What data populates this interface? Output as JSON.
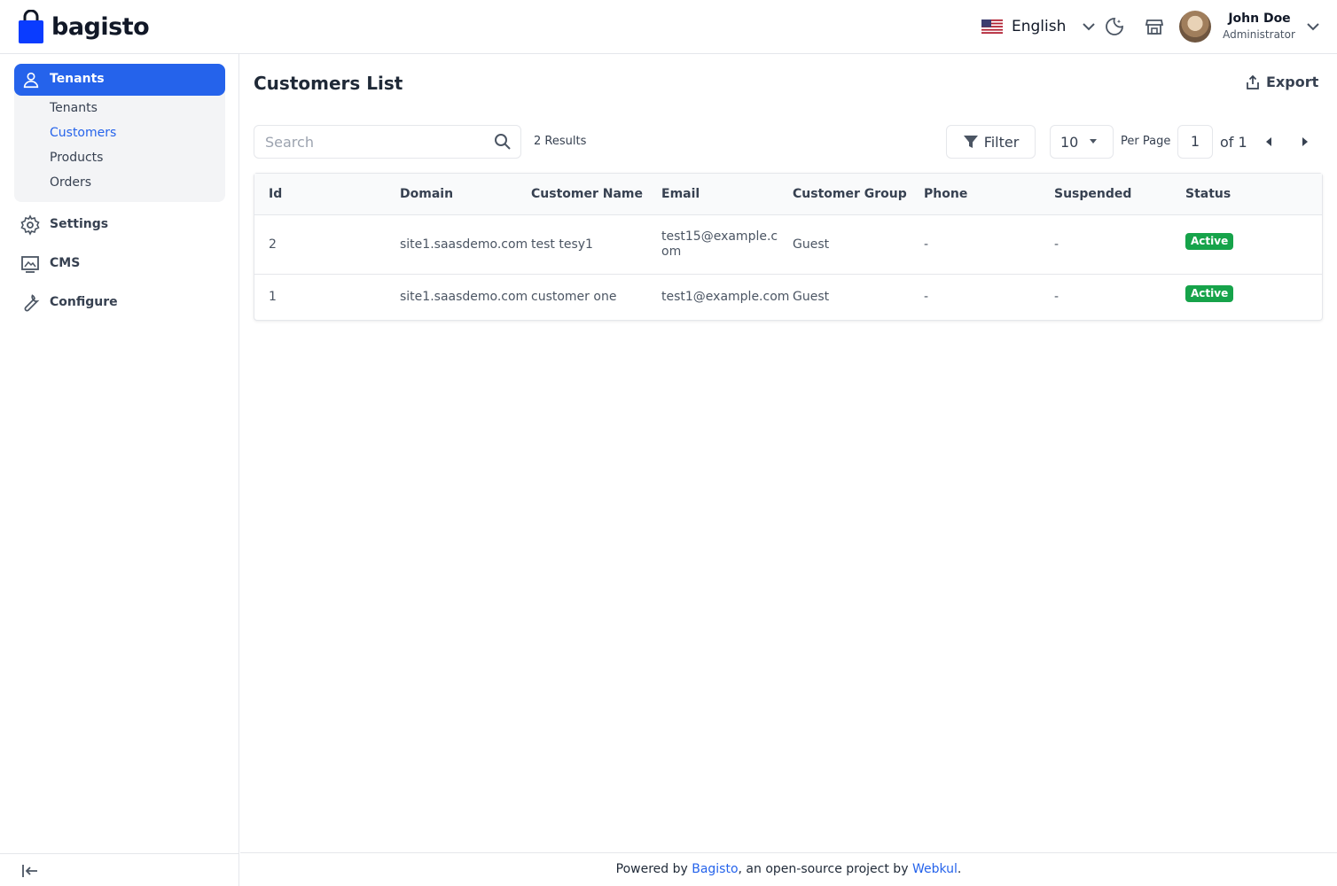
{
  "header": {
    "brand": "bagisto",
    "language": "English",
    "user_name": "John Doe",
    "user_role": "Administrator",
    "icons": [
      "us-flag-icon",
      "chevron-down-icon",
      "dark-mode-icon",
      "storefront-icon",
      "avatar",
      "chevron-down-icon"
    ]
  },
  "sidebar": {
    "active_section": "Tenants",
    "sub_items": [
      {
        "label": "Tenants"
      },
      {
        "label": "Customers"
      },
      {
        "label": "Products"
      },
      {
        "label": "Orders"
      }
    ],
    "active_sub_item": "Customers",
    "items": [
      {
        "label": "Settings",
        "icon": "gear-icon"
      },
      {
        "label": "CMS",
        "icon": "cms-icon"
      },
      {
        "label": "Configure",
        "icon": "wrench-icon"
      }
    ],
    "collapse_icon": "collapse-sidebar-icon"
  },
  "main": {
    "title": "Customers List",
    "export_label": "Export",
    "search_placeholder": "Search",
    "results_count": "2 Results",
    "filter_label": "Filter",
    "per_page_value": "10",
    "per_page_label": "Per Page",
    "current_page": "1",
    "of_pages": "of 1"
  },
  "table": {
    "columns": [
      "Id",
      "Domain",
      "Customer Name",
      "Email",
      "Customer Group",
      "Phone",
      "Suspended",
      "Status"
    ],
    "rows": [
      {
        "id": "2",
        "domain": "site1.saasdemo.com",
        "name": "test tesy1",
        "email": "test15@example.com",
        "group": "Guest",
        "phone": "-",
        "suspended": "-",
        "status": "Active"
      },
      {
        "id": "1",
        "domain": "site1.saasdemo.com",
        "name": "customer one",
        "email": "test1@example.com",
        "group": "Guest",
        "phone": "-",
        "suspended": "-",
        "status": "Active"
      }
    ]
  },
  "footer": {
    "prefix": "Powered by ",
    "link1": "Bagisto",
    "middle": ", an open-source project by ",
    "link2": "Webkul",
    "suffix": "."
  },
  "colors": {
    "accent": "#2563eb",
    "status_active": "#16a34a",
    "border": "#e5e7eb"
  }
}
